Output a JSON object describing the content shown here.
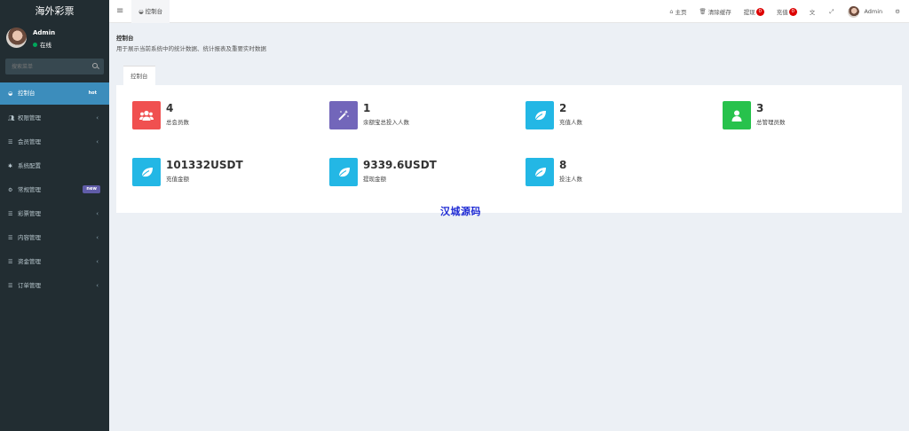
{
  "app": {
    "title": "海外彩票"
  },
  "user": {
    "name": "Admin",
    "status": "在线"
  },
  "search": {
    "placeholder": "搜索菜单"
  },
  "menu": [
    {
      "label": "控制台",
      "icon": "dashboard-icon",
      "badge": "hot",
      "active": true
    },
    {
      "label": "权限管理",
      "icon": "users-icon",
      "has_children": true
    },
    {
      "label": "会员管理",
      "icon": "list-icon",
      "has_children": true
    },
    {
      "label": "系统配置",
      "icon": "gear-icon"
    },
    {
      "label": "常规管理",
      "icon": "cogs-icon",
      "badge": "new"
    },
    {
      "label": "彩票管理",
      "icon": "list-icon",
      "has_children": true
    },
    {
      "label": "内容管理",
      "icon": "list-icon",
      "has_children": true
    },
    {
      "label": "资金管理",
      "icon": "list-icon",
      "has_children": true
    },
    {
      "label": "订单管理",
      "icon": "list-icon",
      "has_children": true
    }
  ],
  "header": {
    "tab": "控制台",
    "home": "主页",
    "clear_cache": "清除缓存",
    "withdraw": "提现",
    "withdraw_count": "0",
    "recharge": "充值",
    "recharge_count": "0",
    "user": "Admin"
  },
  "page": {
    "title": "控制台",
    "description": "用于展示当前系统中的统计数据、统计报表及重要实时数据",
    "subtab": "控制台"
  },
  "stats": [
    {
      "value": "4",
      "label": "总会员数",
      "icon": "users-icon",
      "color": "#f05050"
    },
    {
      "value": "1",
      "label": "余额宝总投入人数",
      "icon": "magic-wand-icon",
      "color": "#7266ba"
    },
    {
      "value": "2",
      "label": "充值人数",
      "icon": "leaf-icon",
      "color": "#23b7e5"
    },
    {
      "value": "3",
      "label": "总管理员数",
      "icon": "user-icon",
      "color": "#27c24c"
    },
    {
      "value": "101332USDT",
      "label": "充值金额",
      "icon": "leaf-icon",
      "color": "#23b7e5"
    },
    {
      "value": "9339.6USDT",
      "label": "提现金额",
      "icon": "leaf-icon",
      "color": "#23b7e5"
    },
    {
      "value": "8",
      "label": "投注人数",
      "icon": "leaf-icon",
      "color": "#23b7e5"
    }
  ],
  "watermark": "汉城源码"
}
